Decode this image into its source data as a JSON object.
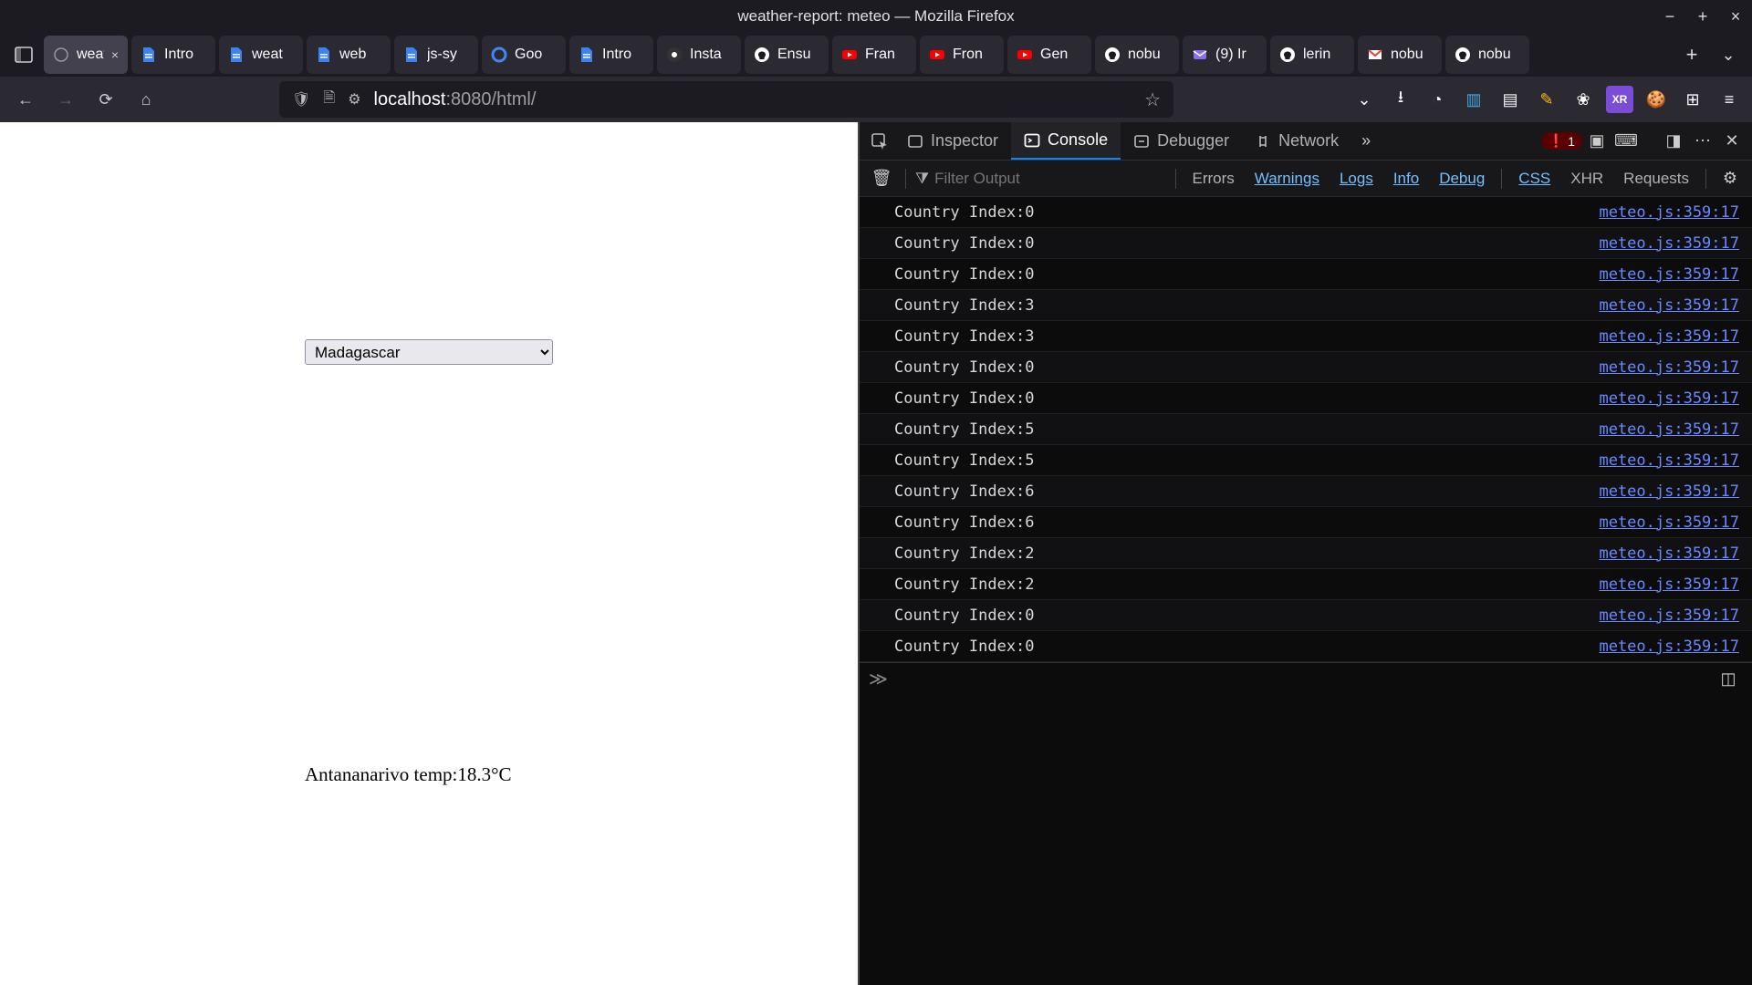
{
  "window": {
    "title": "weather-report: meteo — Mozilla Firefox"
  },
  "tabs": [
    {
      "label": "weatl",
      "active": true,
      "icon": "globe",
      "close": true
    },
    {
      "label": "Intro",
      "active": false,
      "icon": "doc-blue",
      "close": false
    },
    {
      "label": "weat",
      "active": false,
      "icon": "doc-blue",
      "close": false
    },
    {
      "label": "web",
      "active": false,
      "icon": "doc-blue",
      "close": false
    },
    {
      "label": "js-sy",
      "active": false,
      "icon": "doc-blue",
      "close": false
    },
    {
      "label": "Goo",
      "active": false,
      "icon": "google",
      "close": false
    },
    {
      "label": "Intro",
      "active": false,
      "icon": "doc-blue",
      "close": false
    },
    {
      "label": "Insta",
      "active": false,
      "icon": "npm",
      "close": false
    },
    {
      "label": "Ensu",
      "active": false,
      "icon": "github",
      "close": false
    },
    {
      "label": "Fran",
      "active": false,
      "icon": "youtube",
      "close": false
    },
    {
      "label": "Fron",
      "active": false,
      "icon": "youtube",
      "close": false
    },
    {
      "label": "Gen",
      "active": false,
      "icon": "youtube",
      "close": false
    },
    {
      "label": "nobu",
      "active": false,
      "icon": "github",
      "close": false
    },
    {
      "label": "(9) Ir",
      "active": false,
      "icon": "proton",
      "close": false
    },
    {
      "label": "lerin",
      "active": false,
      "icon": "github",
      "close": false
    },
    {
      "label": "nobu",
      "active": false,
      "icon": "gmail",
      "close": false
    },
    {
      "label": "nobu",
      "active": false,
      "icon": "github",
      "close": false
    }
  ],
  "url": {
    "host": "localhost",
    "rest": ":8080/html/"
  },
  "page": {
    "country_selected": "Madagascar",
    "temp_line": "Antananarivo temp:18.3°C"
  },
  "devtools": {
    "tabs": {
      "inspector": "Inspector",
      "console": "Console",
      "debugger": "Debugger",
      "network": "Network"
    },
    "error_count": "1",
    "filter_placeholder": "Filter Output",
    "chips": {
      "errors": "Errors",
      "warnings": "Warnings",
      "logs": "Logs",
      "info": "Info",
      "debug": "Debug",
      "css": "CSS",
      "xhr": "XHR",
      "requests": "Requests"
    },
    "src": "meteo.js:359:17",
    "logs": [
      "Country Index:0",
      "Country Index:0",
      "Country Index:0",
      "Country Index:3",
      "Country Index:3",
      "Country Index:0",
      "Country Index:0",
      "Country Index:5",
      "Country Index:5",
      "Country Index:6",
      "Country Index:6",
      "Country Index:2",
      "Country Index:2",
      "Country Index:0",
      "Country Index:0"
    ],
    "prompt": "≫"
  }
}
